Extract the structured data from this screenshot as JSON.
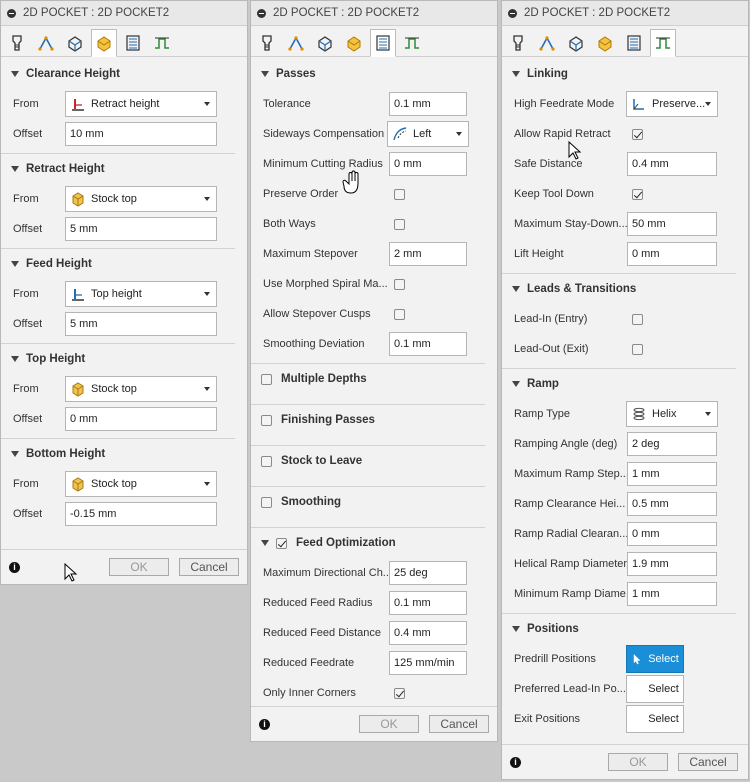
{
  "icons": {
    "tabs": [
      "tool-tab-icon",
      "geometry-tab-icon",
      "heights-tab-icon",
      "passes-tab-icon",
      "linking-tab-icon",
      "post-tab-icon"
    ]
  },
  "dialog1": {
    "title": "2D POCKET : 2D POCKET2",
    "active_tab": 3,
    "sections": [
      {
        "title": "Clearance Height",
        "from_label": "From",
        "from_value": "Retract height",
        "from_icon": "retract-height-icon",
        "offset_label": "Offset",
        "offset_value": "10 mm"
      },
      {
        "title": "Retract Height",
        "from_label": "From",
        "from_value": "Stock top",
        "from_icon": "stock-top-icon",
        "offset_label": "Offset",
        "offset_value": "5 mm"
      },
      {
        "title": "Feed Height",
        "from_label": "From",
        "from_value": "Top height",
        "from_icon": "top-height-icon",
        "offset_label": "Offset",
        "offset_value": "5 mm"
      },
      {
        "title": "Top Height",
        "from_label": "From",
        "from_value": "Stock top",
        "from_icon": "stock-top-icon",
        "offset_label": "Offset",
        "offset_value": "0 mm"
      },
      {
        "title": "Bottom Height",
        "from_label": "From",
        "from_value": "Stock top",
        "from_icon": "stock-top-icon",
        "offset_label": "Offset",
        "offset_value": "-0.15 mm"
      }
    ],
    "ok_label": "OK",
    "cancel_label": "Cancel"
  },
  "dialog2": {
    "title": "2D POCKET : 2D POCKET2",
    "passes": {
      "title": "Passes",
      "tolerance_label": "Tolerance",
      "tolerance_value": "0.1 mm",
      "sideways_label": "Sideways Compensation",
      "sideways_value": "Left",
      "min_radius_label": "Minimum Cutting Radius",
      "min_radius_value": "0 mm",
      "preserve_order_label": "Preserve Order",
      "preserve_order_checked": false,
      "both_ways_label": "Both Ways",
      "both_ways_checked": false,
      "max_stepover_label": "Maximum Stepover",
      "max_stepover_value": "2 mm",
      "morphed_label": "Use Morphed Spiral Ma...",
      "morphed_checked": false,
      "cusps_label": "Allow Stepover Cusps",
      "cusps_checked": false,
      "smoothing_dev_label": "Smoothing Deviation",
      "smoothing_dev_value": "0.1 mm"
    },
    "multiple_depths": "Multiple Depths",
    "finishing_passes": "Finishing Passes",
    "stock_to_leave": "Stock to Leave",
    "smoothing": "Smoothing",
    "feed_opt": {
      "title": "Feed Optimization",
      "checked": true,
      "max_dir_label": "Maximum Directional Ch...",
      "max_dir_value": "25 deg",
      "red_radius_label": "Reduced Feed Radius",
      "red_radius_value": "0.1 mm",
      "red_dist_label": "Reduced Feed Distance",
      "red_dist_value": "0.4 mm",
      "red_feed_label": "Reduced Feedrate",
      "red_feed_value": "125 mm/min",
      "inner_label": "Only Inner Corners",
      "inner_checked": true
    },
    "ok_label": "OK",
    "cancel_label": "Cancel"
  },
  "dialog3": {
    "title": "2D POCKET : 2D POCKET2",
    "linking": {
      "title": "Linking",
      "hf_mode_label": "High Feedrate Mode",
      "hf_mode_value": "Preserve...",
      "rapid_label": "Allow Rapid Retract",
      "rapid_checked": true,
      "safe_label": "Safe Distance",
      "safe_value": "0.4 mm",
      "keep_label": "Keep Tool Down",
      "keep_checked": true,
      "stay_label": "Maximum Stay-Down...",
      "stay_value": "50 mm",
      "lift_label": "Lift Height",
      "lift_value": "0 mm"
    },
    "leads": {
      "title": "Leads & Transitions",
      "in_label": "Lead-In (Entry)",
      "in_checked": false,
      "out_label": "Lead-Out (Exit)",
      "out_checked": false
    },
    "ramp": {
      "title": "Ramp",
      "type_label": "Ramp Type",
      "type_value": "Helix",
      "angle_label": "Ramping Angle (deg)",
      "angle_value": "2 deg",
      "max_step_label": "Maximum Ramp Step...",
      "max_step_value": "1 mm",
      "clear_label": "Ramp Clearance Hei...",
      "clear_value": "0.5 mm",
      "radial_label": "Ramp Radial Clearan...",
      "radial_value": "0 mm",
      "helical_label": "Helical Ramp Diameter",
      "helical_value": "1.9 mm",
      "min_diam_label": "Minimum Ramp Diame...",
      "min_diam_value": "1 mm"
    },
    "positions": {
      "title": "Positions",
      "predrill_label": "Predrill Positions",
      "preferred_label": "Preferred Lead-In Po...",
      "exit_label": "Exit Positions",
      "select_label": "Select"
    },
    "ok_label": "OK",
    "cancel_label": "Cancel"
  }
}
